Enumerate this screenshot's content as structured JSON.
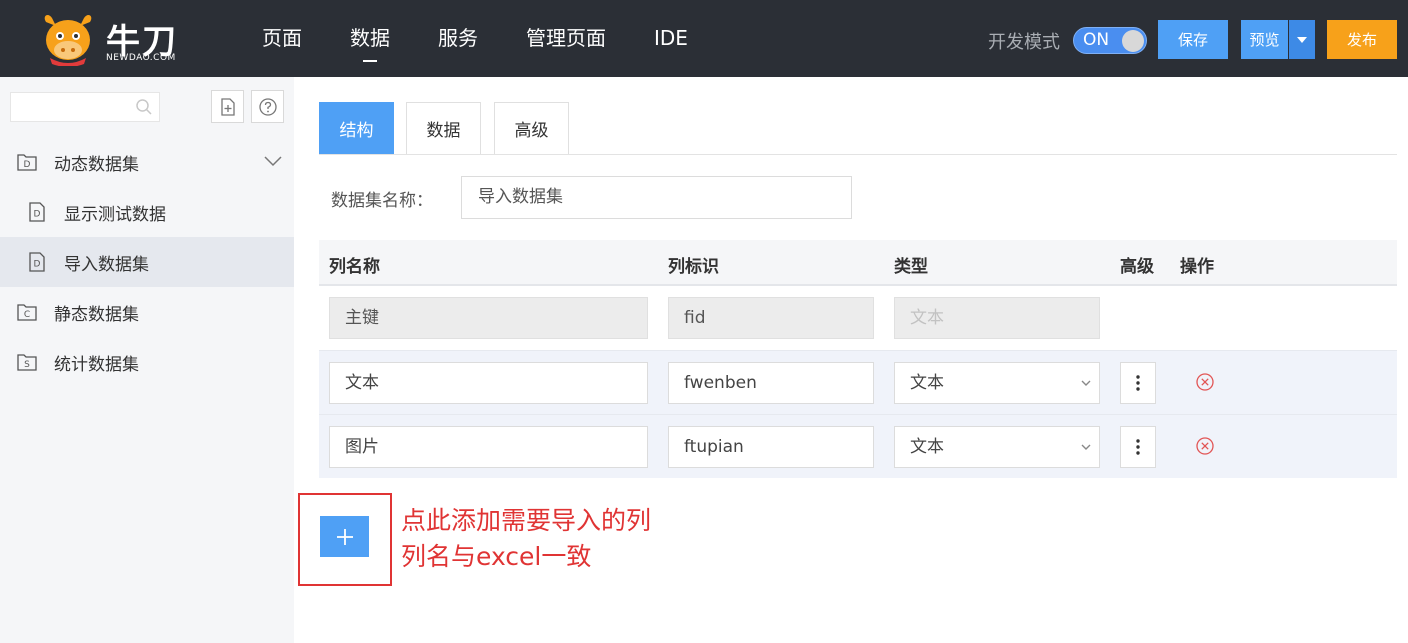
{
  "header": {
    "logo_text": "牛刀",
    "logo_sub": "NEWDAO.COM",
    "nav": [
      "页面",
      "数据",
      "服务",
      "管理页面",
      "IDE"
    ],
    "dev_mode_label": "开发模式",
    "dev_mode_state": "ON",
    "save_label": "保存",
    "preview_label": "预览",
    "publish_label": "发布"
  },
  "sidebar": {
    "search_placeholder": "",
    "items": [
      {
        "label": "动态数据集",
        "icon": "D",
        "level": 1,
        "expanded": true
      },
      {
        "label": "显示测试数据",
        "icon": "D",
        "level": 2
      },
      {
        "label": "导入数据集",
        "icon": "D",
        "level": 2,
        "selected": true
      },
      {
        "label": "静态数据集",
        "icon": "C",
        "level": 1
      },
      {
        "label": "统计数据集",
        "icon": "S",
        "level": 1
      }
    ]
  },
  "main": {
    "tabs": [
      "结构",
      "数据",
      "高级"
    ],
    "active_tab": "结构",
    "dataset_name_label": "数据集名称：",
    "dataset_name_value": "导入数据集",
    "columns": {
      "name": "列名称",
      "id": "列标识",
      "type": "类型",
      "advanced": "高级",
      "action": "操作"
    },
    "rows": [
      {
        "name": "主键",
        "id": "fid",
        "type": "文本",
        "locked": true
      },
      {
        "name": "文本",
        "id": "fwenben",
        "type": "文本",
        "locked": false
      },
      {
        "name": "图片",
        "id": "ftupian",
        "type": "文本",
        "locked": false
      }
    ],
    "add_label": "+"
  },
  "annotation": {
    "line1": "点此添加需要导入的列",
    "line2": "列名与excel一致"
  },
  "colors": {
    "topbar": "#2b2f36",
    "primary": "#4fa0f5",
    "publish": "#f7a11a",
    "annotation": "#e03434",
    "delete": "#e25555"
  }
}
